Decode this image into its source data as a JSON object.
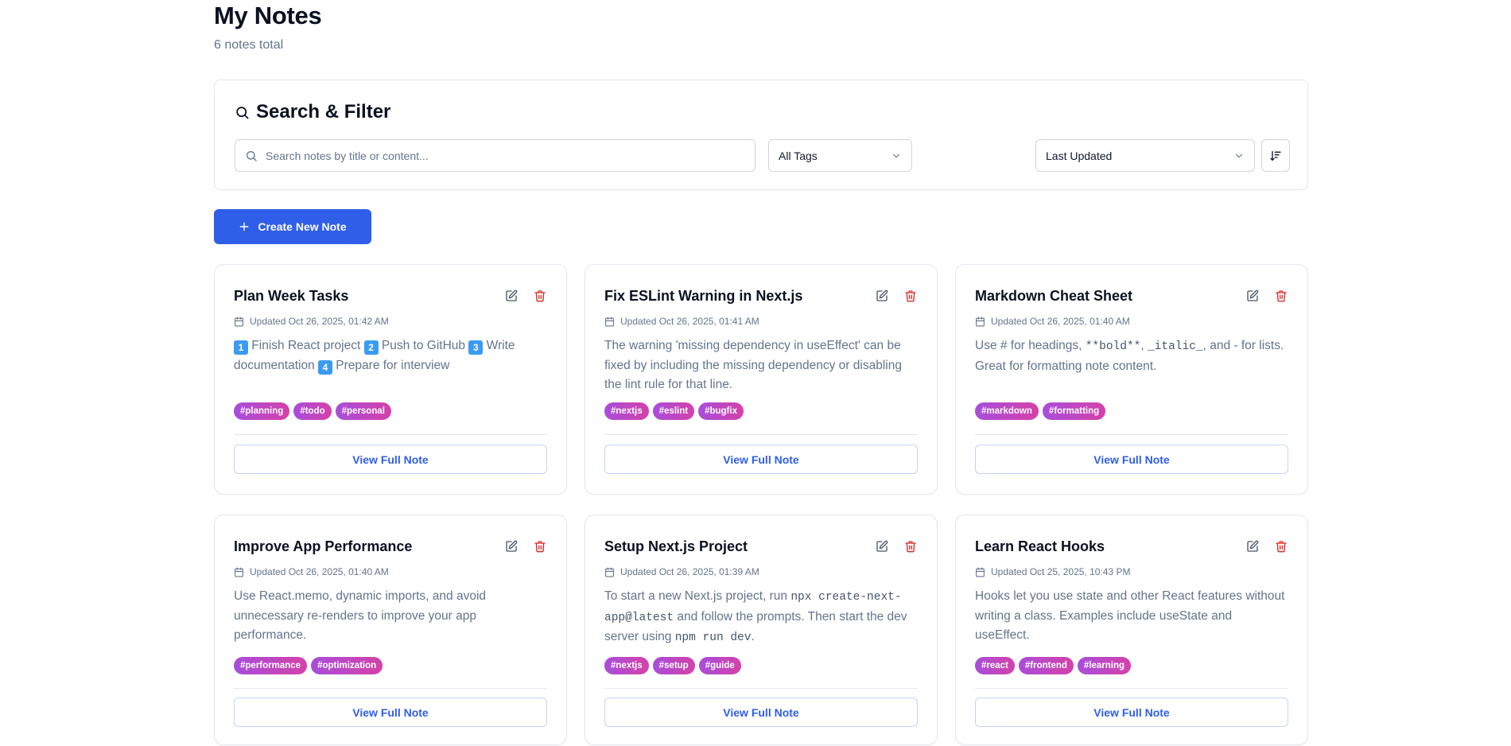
{
  "header": {
    "title": "My Notes",
    "subtitle": "6 notes total"
  },
  "filter": {
    "title": "Search & Filter",
    "search_placeholder": "Search notes by title or content...",
    "tags_select": "All Tags",
    "sort_select": "Last Updated"
  },
  "create_button": "Create New Note",
  "colors": {
    "primary": "#2f5ee8",
    "delete": "#dc2626",
    "tag_gradient_start": "#a84ddb",
    "tag_gradient_end": "#d442a8"
  },
  "notes": [
    {
      "title": "Plan Week Tasks",
      "updated": "Updated Oct 26, 2025, 01:42 AM",
      "content": [
        {
          "emoji": "1"
        },
        {
          "text": " Finish React project "
        },
        {
          "emoji": "2"
        },
        {
          "text": " Push to GitHub "
        },
        {
          "emoji": "3"
        },
        {
          "text": " Write documentation "
        },
        {
          "emoji": "4"
        },
        {
          "text": " Prepare for interview"
        }
      ],
      "tags": [
        "#planning",
        "#todo",
        "#personal"
      ],
      "view_label": "View Full Note"
    },
    {
      "title": "Fix ESLint Warning in Next.js",
      "updated": "Updated Oct 26, 2025, 01:41 AM",
      "content": [
        {
          "text": "The warning 'missing dependency in useEffect' can be fixed by including the missing dependency or disabling the lint rule for that line."
        }
      ],
      "tags": [
        "#nextjs",
        "#eslint",
        "#bugfix"
      ],
      "view_label": "View Full Note"
    },
    {
      "title": "Markdown Cheat Sheet",
      "updated": "Updated Oct 26, 2025, 01:40 AM",
      "content": [
        {
          "text": "Use # for headings, "
        },
        {
          "code": "**bold**"
        },
        {
          "text": ", "
        },
        {
          "code": "_italic_"
        },
        {
          "text": ", and - for lists. Great for formatting note content."
        }
      ],
      "tags": [
        "#markdown",
        "#formatting"
      ],
      "view_label": "View Full Note"
    },
    {
      "title": "Improve App Performance",
      "updated": "Updated Oct 26, 2025, 01:40 AM",
      "content": [
        {
          "text": "Use React.memo, dynamic imports, and avoid unnecessary re-renders to improve your app performance."
        }
      ],
      "tags": [
        "#performance",
        "#optimization"
      ],
      "view_label": "View Full Note"
    },
    {
      "title": "Setup Next.js Project",
      "updated": "Updated Oct 26, 2025, 01:39 AM",
      "content": [
        {
          "text": "To start a new Next.js project, run "
        },
        {
          "code": "npx create-next-app@latest"
        },
        {
          "text": " and follow the prompts. Then start the dev server using "
        },
        {
          "code": "npm run dev"
        },
        {
          "text": "."
        }
      ],
      "tags": [
        "#nextjs",
        "#setup",
        "#guide"
      ],
      "view_label": "View Full Note"
    },
    {
      "title": "Learn React Hooks",
      "updated": "Updated Oct 25, 2025, 10:43 PM",
      "content": [
        {
          "text": "Hooks let you use state and other React features without writing a class. Examples include useState and useEffect."
        }
      ],
      "tags": [
        "#react",
        "#frontend",
        "#learning"
      ],
      "view_label": "View Full Note"
    }
  ]
}
